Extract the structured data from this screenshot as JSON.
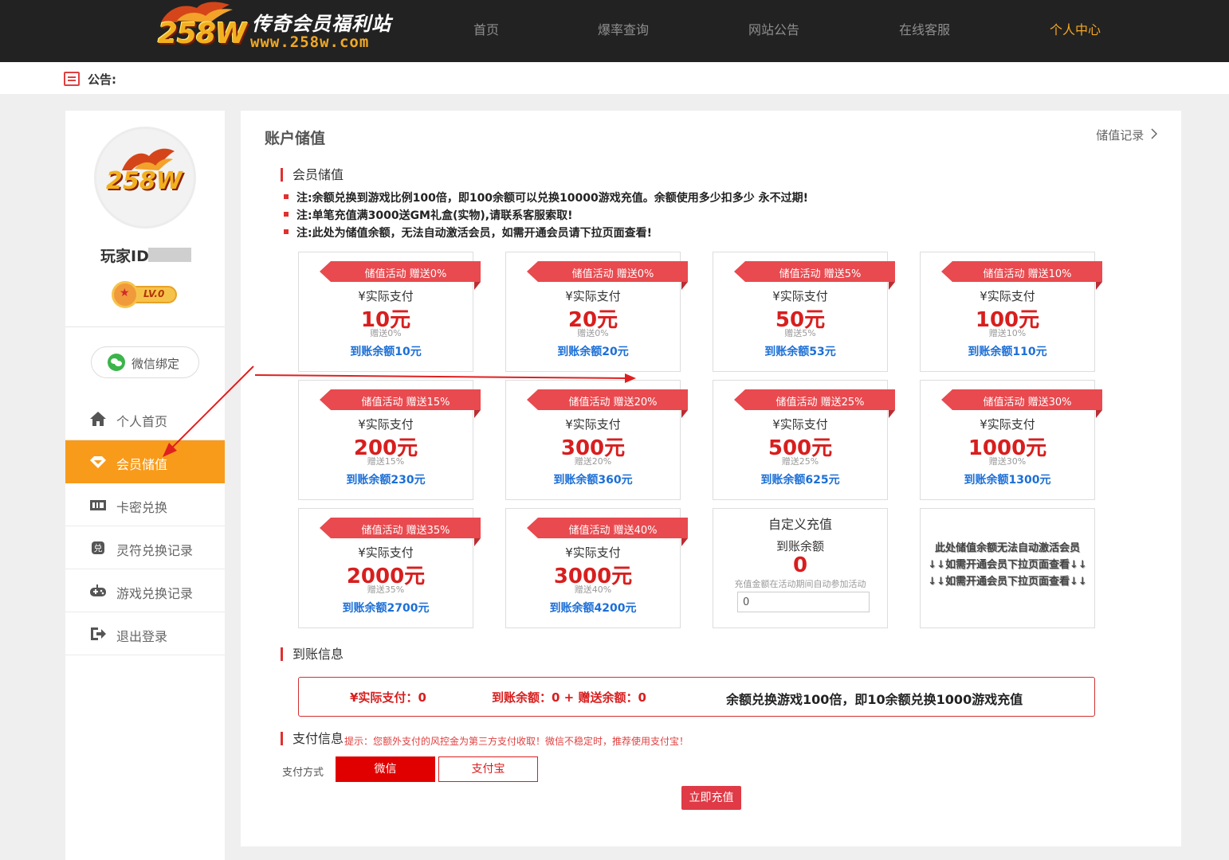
{
  "site": {
    "logo_badge": "258W",
    "logo_title": "传奇会员福利站",
    "logo_url": "www.258w.com"
  },
  "nav": {
    "items": [
      {
        "label": "首页",
        "active": false
      },
      {
        "label": "爆率查询",
        "active": false
      },
      {
        "label": "网站公告",
        "active": false
      },
      {
        "label": "在线客服",
        "active": false
      },
      {
        "label": "个人中心",
        "active": true
      }
    ]
  },
  "notice": {
    "label": "公告:"
  },
  "profile": {
    "avatar_text": "258W",
    "player_id_label": "玩家ID",
    "level": "LV.0",
    "wechat_bind": "微信绑定"
  },
  "sidebar": {
    "items": [
      {
        "label": "个人首页",
        "icon": "home-icon",
        "active": false
      },
      {
        "label": "会员储值",
        "icon": "diamond-icon",
        "active": true
      },
      {
        "label": "卡密兑换",
        "icon": "ticket-icon",
        "active": false
      },
      {
        "label": "灵符兑换记录",
        "icon": "exchange-icon",
        "active": false
      },
      {
        "label": "游戏兑换记录",
        "icon": "gamepad-icon",
        "active": false
      },
      {
        "label": "退出登录",
        "icon": "logout-icon",
        "active": false
      }
    ]
  },
  "main": {
    "title": "账户储值",
    "record_link": "储值记录",
    "member_section": "会员储值",
    "notes": [
      "注:余额兑换到游戏比例100倍，即100余额可以兑换10000游戏充值。余额使用多少扣多少 永不过期!",
      "注:单笔充值满3000送GM礼盒(实物),请联系客服索取!",
      "注:此处为储值余额，无法自动激活会员，如需开通会员请下拉页面查看!"
    ]
  },
  "packages": [
    {
      "ribbon": "储值活动 赠送0%",
      "pay_label": "¥实际支付",
      "price": "10元",
      "bonus": "赠送0%",
      "credit": "到账余额10元"
    },
    {
      "ribbon": "储值活动 赠送0%",
      "pay_label": "¥实际支付",
      "price": "20元",
      "bonus": "赠送0%",
      "credit": "到账余额20元"
    },
    {
      "ribbon": "储值活动 赠送5%",
      "pay_label": "¥实际支付",
      "price": "50元",
      "bonus": "赠送5%",
      "credit": "到账余额53元"
    },
    {
      "ribbon": "储值活动 赠送10%",
      "pay_label": "¥实际支付",
      "price": "100元",
      "bonus": "赠送10%",
      "credit": "到账余额110元"
    },
    {
      "ribbon": "储值活动 赠送15%",
      "pay_label": "¥实际支付",
      "price": "200元",
      "bonus": "赠送15%",
      "credit": "到账余额230元"
    },
    {
      "ribbon": "储值活动 赠送20%",
      "pay_label": "¥实际支付",
      "price": "300元",
      "bonus": "赠送20%",
      "credit": "到账余额360元"
    },
    {
      "ribbon": "储值活动 赠送25%",
      "pay_label": "¥实际支付",
      "price": "500元",
      "bonus": "赠送25%",
      "credit": "到账余额625元"
    },
    {
      "ribbon": "储值活动 赠送30%",
      "pay_label": "¥实际支付",
      "price": "1000元",
      "bonus": "赠送30%",
      "credit": "到账余额1300元"
    },
    {
      "ribbon": "储值活动 赠送35%",
      "pay_label": "¥实际支付",
      "price": "2000元",
      "bonus": "赠送35%",
      "credit": "到账余额2700元"
    },
    {
      "ribbon": "储值活动 赠送40%",
      "pay_label": "¥实际支付",
      "price": "3000元",
      "bonus": "赠送40%",
      "credit": "到账余额4200元"
    }
  ],
  "custom": {
    "title": "自定义充值",
    "credit_label": "到账余额",
    "credit_value": "0",
    "hint": "充值金额在活动期间自动参加活动",
    "input_value": "0"
  },
  "warning": {
    "lines": [
      "此处储值余额无法自动激活会员",
      "↓↓如需开通会员下拉页面查看↓↓",
      "↓↓如需开通会员下拉页面查看↓↓"
    ]
  },
  "arrival": {
    "section_title": "到账信息",
    "pay": "¥实际支付：0",
    "credit": "到账余额：0 + 赠送余额：0",
    "rate": "余额兑换游戏100倍，即10余额兑换1000游戏充值"
  },
  "payment": {
    "section_title": "支付信息",
    "hint": "提示：您额外支付的风控金为第三方支付收取！微信不稳定时，推荐使用支付宝！",
    "method_label": "支付方式",
    "methods": [
      {
        "label": "微信",
        "selected": true
      },
      {
        "label": "支付宝",
        "selected": false
      }
    ],
    "submit": "立即充值"
  },
  "colors": {
    "topbar": "#222222",
    "accent_orange": "#f89b1b",
    "price_red": "#d81e1e",
    "credit_blue": "#1c6fd6",
    "ribbon_red": "#e84a4f"
  }
}
